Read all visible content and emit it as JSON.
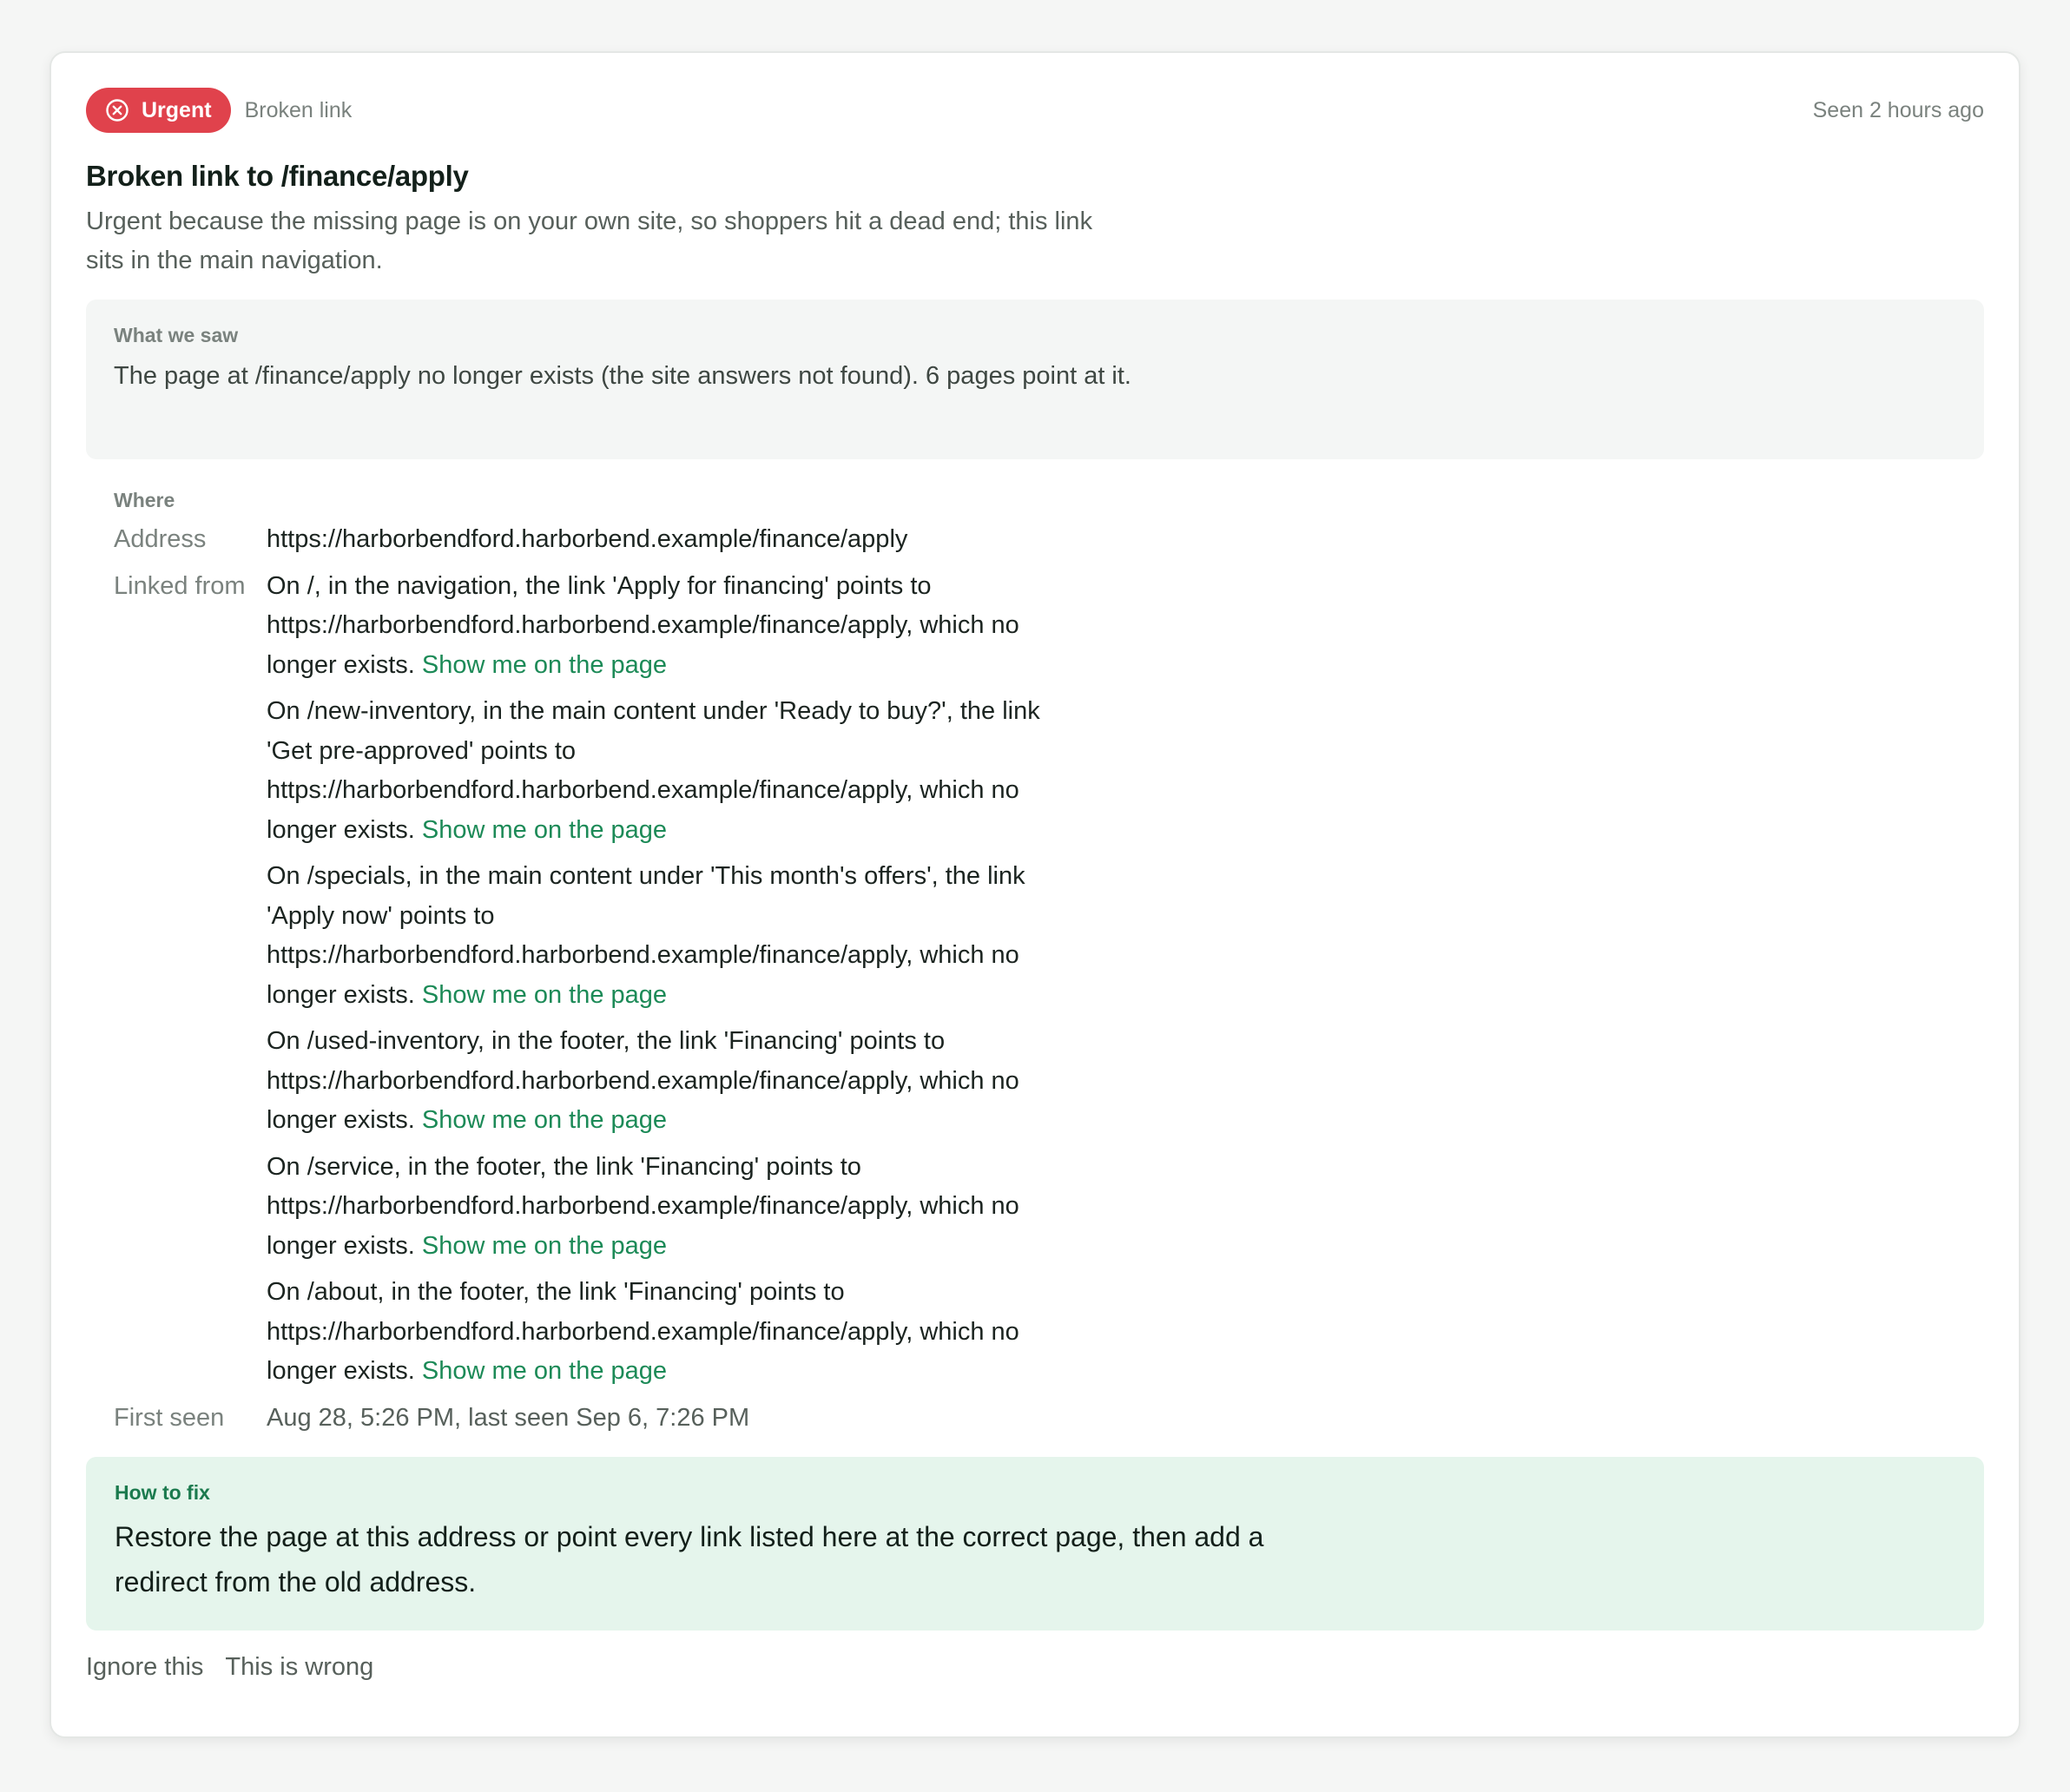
{
  "header": {
    "badge_label": "Urgent",
    "category": "Broken link",
    "seen_ago": "Seen 2 hours ago"
  },
  "title": "Broken link to /finance/apply",
  "summary": "Urgent because the missing page is on your own site, so shoppers hit a dead end; this link sits in the main navigation.",
  "what_we_saw": {
    "label": "What we saw",
    "text": "The page at /finance/apply no longer exists (the site answers not found). 6 pages point at it."
  },
  "where": {
    "label": "Where",
    "address_label": "Address",
    "address_value": "https://harborbendford.harborbend.example/finance/apply",
    "linked_from_label": "Linked from",
    "linked_from": [
      {
        "text": "On /, in the navigation, the link 'Apply for financing' points to https://harborbendford.harborbend.example/finance/apply, which no longer exists.",
        "link": "Show me on the page"
      },
      {
        "text": "On /new-inventory, in the main content under 'Ready to buy?', the link 'Get pre-approved' points to https://harborbendford.harborbend.example/finance/apply, which no longer exists.",
        "link": "Show me on the page"
      },
      {
        "text": "On /specials, in the main content under 'This month's offers', the link 'Apply now' points to https://harborbendford.harborbend.example/finance/apply, which no longer exists.",
        "link": "Show me on the page"
      },
      {
        "text": "On /used-inventory, in the footer, the link 'Financing' points to https://harborbendford.harborbend.example/finance/apply, which no longer exists.",
        "link": "Show me on the page"
      },
      {
        "text": "On /service, in the footer, the link 'Financing' points to https://harborbendford.harborbend.example/finance/apply, which no longer exists.",
        "link": "Show me on the page"
      },
      {
        "text": "On /about, in the footer, the link 'Financing' points to https://harborbendford.harborbend.example/finance/apply, which no longer exists.",
        "link": "Show me on the page"
      }
    ],
    "first_seen_label": "First seen",
    "first_seen_value": "Aug 28, 5:26 PM, last seen Sep 6, 7:26 PM"
  },
  "how_to_fix": {
    "label": "How to fix",
    "text": "Restore the page at this address or point every link listed here at the correct page, then add a redirect from the old address."
  },
  "actions": {
    "ignore": "Ignore this",
    "wrong": "This is wrong"
  },
  "colors": {
    "urgent": "#e0424c",
    "link_green": "#1c8a57",
    "fix_bg": "#e5f5ec",
    "saw_bg": "#f4f6f5"
  },
  "icons": {
    "badge": "x-circle-icon"
  }
}
